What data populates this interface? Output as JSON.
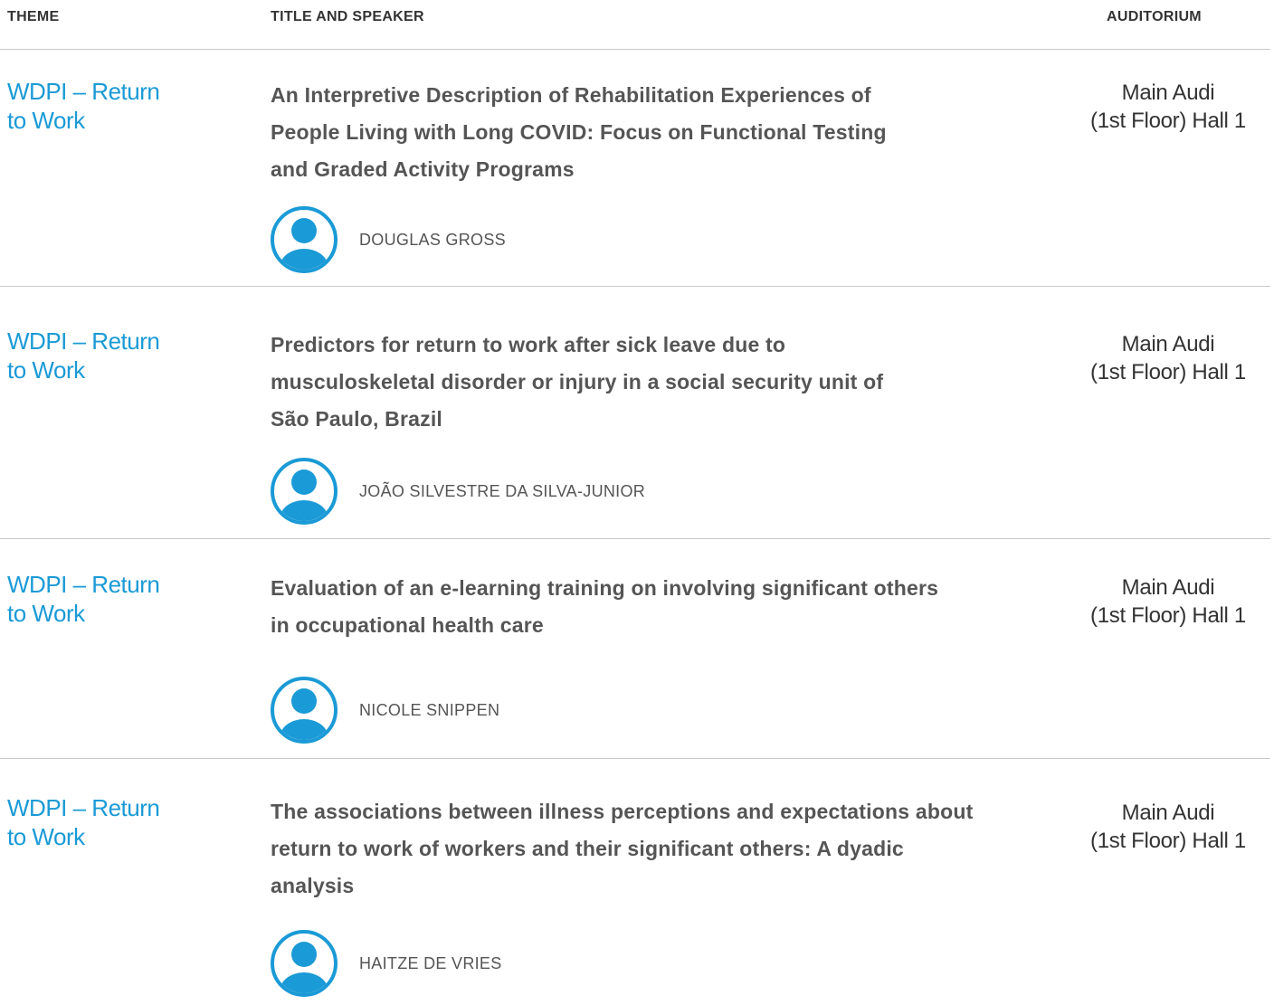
{
  "header": {
    "theme": "THEME",
    "title_speaker": "TITLE AND SPEAKER",
    "auditorium": "AUDITORIUM"
  },
  "sessions": [
    {
      "theme_line1": "WDPI – Return",
      "theme_line2": "to Work",
      "title": "An Interpretive Description of Rehabilitation Experiences of People Living with Long COVID: Focus on Functional Testing and Graded Activity Programs",
      "speaker": "DOUGLAS GROSS",
      "auditorium_line1": "Main Audi",
      "auditorium_line2": "(1st Floor) Hall 1"
    },
    {
      "theme_line1": "WDPI – Return",
      "theme_line2": "to Work",
      "title": "Predictors for return to work after sick leave due to musculoskeletal disorder or injury in a social security unit of São Paulo, Brazil",
      "speaker": "JOÃO SILVESTRE DA SILVA-JUNIOR",
      "auditorium_line1": "Main Audi",
      "auditorium_line2": "(1st Floor) Hall 1"
    },
    {
      "theme_line1": "WDPI – Return",
      "theme_line2": "to Work",
      "title": "Evaluation of an e-learning training on involving significant others in occupational health care",
      "speaker": "NICOLE SNIPPEN",
      "auditorium_line1": "Main Audi",
      "auditorium_line2": "(1st Floor) Hall 1"
    },
    {
      "theme_line1": "WDPI – Return",
      "theme_line2": "to Work",
      "title": "The associations between illness perceptions and expectations about return to work of workers and their significant others: A dyadic analysis",
      "speaker": "HAITZE DE VRIES",
      "auditorium_line1": "Main Audi",
      "auditorium_line2": "(1st Floor) Hall 1"
    }
  ],
  "icons": {
    "avatar": "user-avatar-icon"
  },
  "colors": {
    "theme_link": "#1a9ad6",
    "avatar": "#1a9ad6",
    "divider": "#c8c8c8",
    "title_text": "#555555"
  }
}
